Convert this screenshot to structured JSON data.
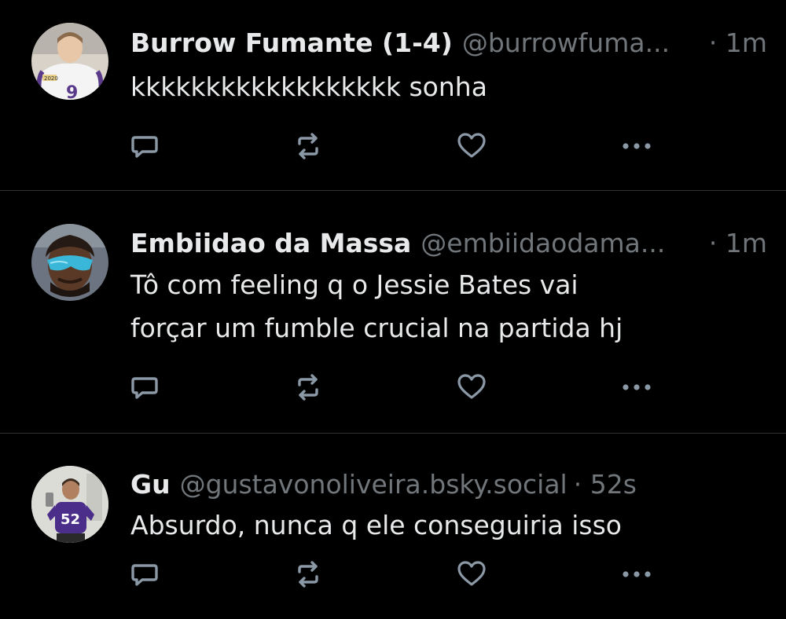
{
  "colors": {
    "background": "#000000",
    "text": "#e7e9ea",
    "secondary_text": "#71767b",
    "divider": "#2f3336",
    "icon": "#8b98a5"
  },
  "posts": [
    {
      "display_name": "Burrow Fumante (1-4)",
      "handle": "@burrowfuma...",
      "time": "· 1m",
      "text": "kkkkkkkkkkkkkkkkkk sonha",
      "avatar_icon": "avatar-football-player-photo"
    },
    {
      "display_name": "Embiidao da Massa",
      "handle": "@embiidaodama...",
      "time": "· 1m",
      "text_lines": [
        "Tô com feeling q o Jessie Bates vai",
        "forçar um fumble crucial na partida hj"
      ],
      "avatar_icon": "avatar-man-with-sunglasses-photo"
    },
    {
      "display_name": "Gu",
      "handle": "@gustavonoliveira.bsky.social",
      "time": "· 52s",
      "text": "Absurdo, nunca q ele conseguiria isso",
      "avatar_icon": "avatar-selfie-purple-jersey-photo"
    }
  ],
  "action_icons": [
    "reply-icon",
    "repost-icon",
    "like-icon",
    "more-options-icon"
  ]
}
